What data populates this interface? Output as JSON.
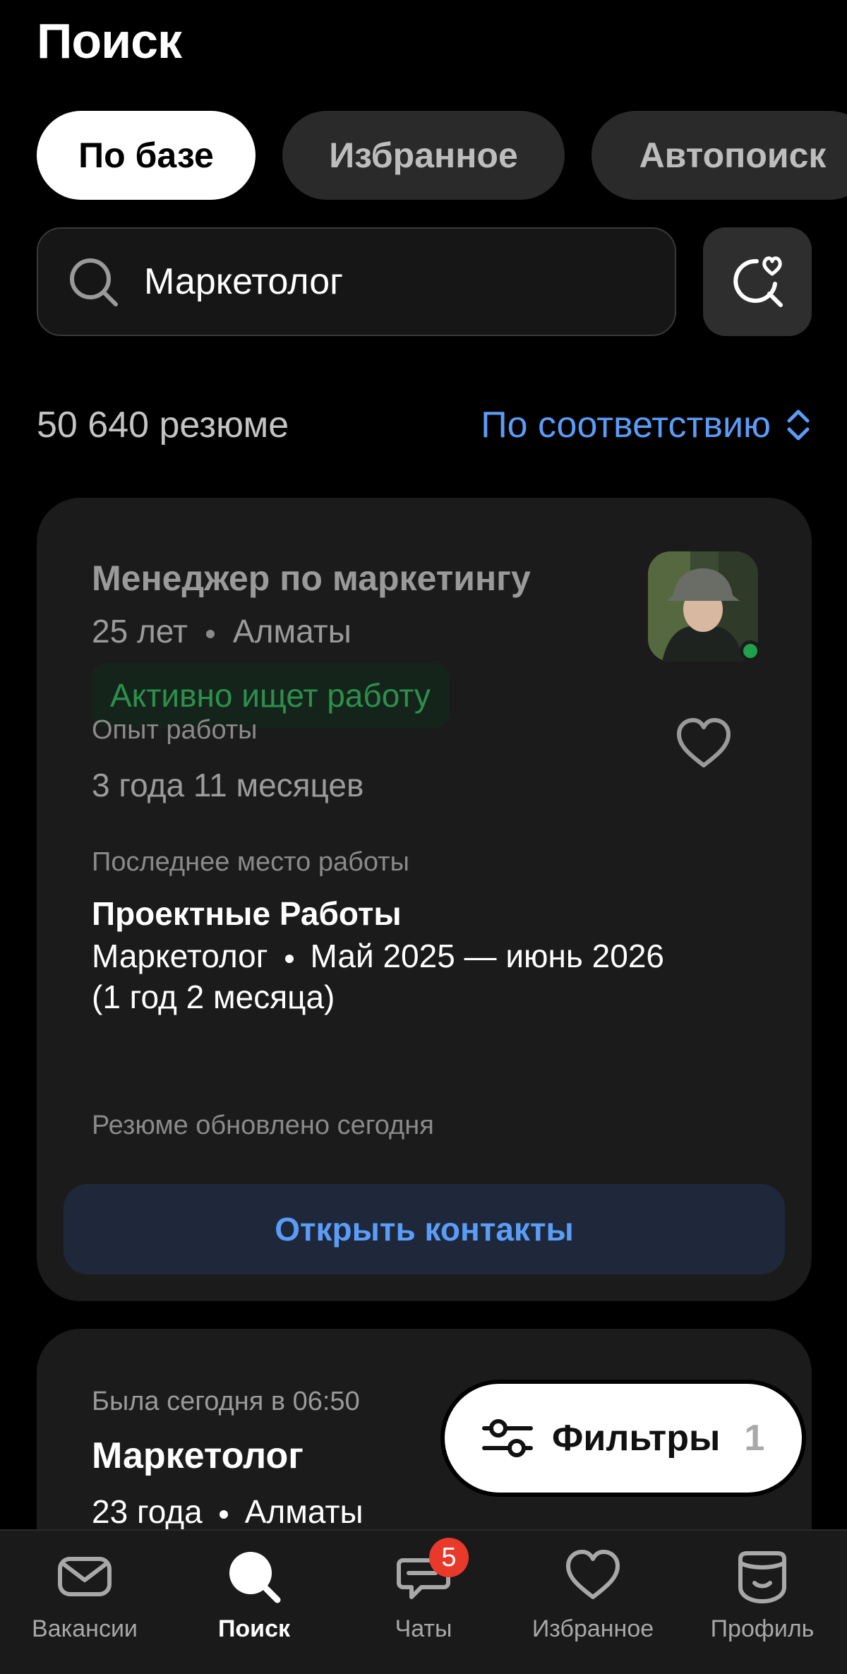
{
  "header": {
    "title": "Поиск"
  },
  "tabs": [
    {
      "label": "По базе",
      "active": true
    },
    {
      "label": "Избранное",
      "active": false
    },
    {
      "label": "Автопоиск",
      "active": false
    }
  ],
  "search": {
    "value": "Маркетолог",
    "icon": "search-icon",
    "saved_icon": "saved-search-icon"
  },
  "results": {
    "count_text": "50 640 резюме",
    "sort_label": "По соответствию"
  },
  "cards": [
    {
      "title": "Менеджер по маркетингу",
      "age": "25 лет",
      "city": "Алматы",
      "status": "Активно ищет работу",
      "experience_label": "Опыт работы",
      "experience_value": "3 года 11 месяцев",
      "last_job_label": "Последнее место работы",
      "last_job_company": "Проектные Работы",
      "last_job_position": "Маркетолог",
      "last_job_period": "Май 2025 — июнь 2026",
      "last_job_duration": "(1 год 2 месяца)",
      "updated": "Резюме обновлено сегодня",
      "open_contacts": "Открыть контакты"
    },
    {
      "last_seen": "Была сегодня в 06:50",
      "title": "Маркетолог",
      "age": "23 года",
      "city": "Алматы"
    }
  ],
  "filters": {
    "label": "Фильтры",
    "count": "1"
  },
  "bottom_nav": [
    {
      "label": "Вакансии",
      "icon": "envelope-icon",
      "active": false
    },
    {
      "label": "Поиск",
      "icon": "search-icon",
      "active": true
    },
    {
      "label": "Чаты",
      "icon": "chat-icon",
      "active": false,
      "badge": "5"
    },
    {
      "label": "Избранное",
      "icon": "heart-icon",
      "active": false
    },
    {
      "label": "Профиль",
      "icon": "profile-icon",
      "active": false
    }
  ],
  "colors": {
    "accent": "#5b9cf7",
    "status_green": "#2c8f4c",
    "badge_red": "#e8392b",
    "card_bg": "#1b1b1b"
  }
}
